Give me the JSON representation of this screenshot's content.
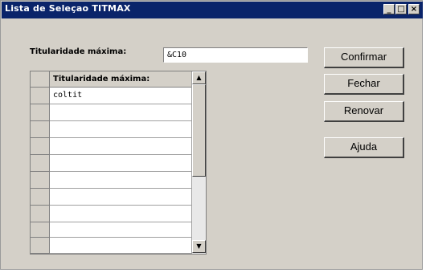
{
  "window": {
    "title": "Lista de Seleçao TITMAX",
    "controls": {
      "minimize": "_",
      "maximize": "□",
      "close": "×"
    }
  },
  "form": {
    "field_label": "Titularidade máxima:",
    "field_value": "&C10"
  },
  "grid": {
    "header": "Titularidade máxima:",
    "rows": [
      "coltit",
      "",
      "",
      "",
      "",
      "",
      "",
      "",
      "",
      ""
    ]
  },
  "scroll": {
    "up": "▲",
    "down": "▼"
  },
  "buttons": {
    "confirm": "Confirmar",
    "close": "Fechar",
    "refresh": "Renovar",
    "help": "Ajuda"
  }
}
